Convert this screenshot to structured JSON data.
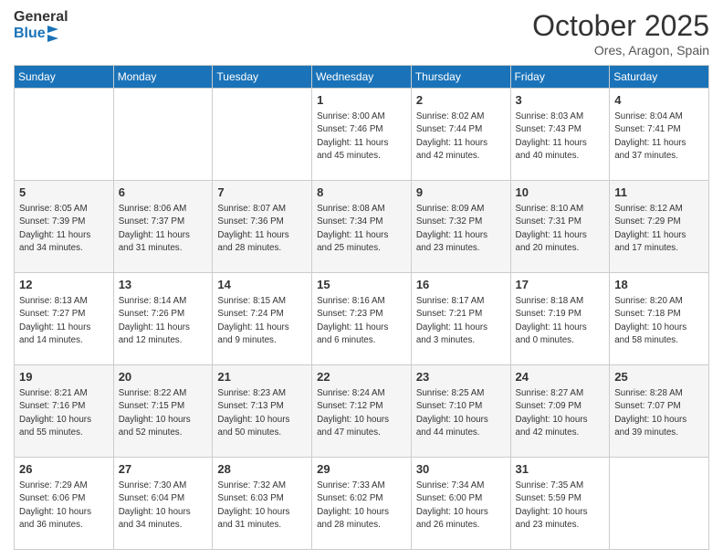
{
  "header": {
    "logo_general": "General",
    "logo_blue": "Blue",
    "month_title": "October 2025",
    "location": "Ores, Aragon, Spain"
  },
  "days_of_week": [
    "Sunday",
    "Monday",
    "Tuesday",
    "Wednesday",
    "Thursday",
    "Friday",
    "Saturday"
  ],
  "weeks": [
    [
      {
        "day": "",
        "info": ""
      },
      {
        "day": "",
        "info": ""
      },
      {
        "day": "",
        "info": ""
      },
      {
        "day": "1",
        "info": "Sunrise: 8:00 AM\nSunset: 7:46 PM\nDaylight: 11 hours\nand 45 minutes."
      },
      {
        "day": "2",
        "info": "Sunrise: 8:02 AM\nSunset: 7:44 PM\nDaylight: 11 hours\nand 42 minutes."
      },
      {
        "day": "3",
        "info": "Sunrise: 8:03 AM\nSunset: 7:43 PM\nDaylight: 11 hours\nand 40 minutes."
      },
      {
        "day": "4",
        "info": "Sunrise: 8:04 AM\nSunset: 7:41 PM\nDaylight: 11 hours\nand 37 minutes."
      }
    ],
    [
      {
        "day": "5",
        "info": "Sunrise: 8:05 AM\nSunset: 7:39 PM\nDaylight: 11 hours\nand 34 minutes."
      },
      {
        "day": "6",
        "info": "Sunrise: 8:06 AM\nSunset: 7:37 PM\nDaylight: 11 hours\nand 31 minutes."
      },
      {
        "day": "7",
        "info": "Sunrise: 8:07 AM\nSunset: 7:36 PM\nDaylight: 11 hours\nand 28 minutes."
      },
      {
        "day": "8",
        "info": "Sunrise: 8:08 AM\nSunset: 7:34 PM\nDaylight: 11 hours\nand 25 minutes."
      },
      {
        "day": "9",
        "info": "Sunrise: 8:09 AM\nSunset: 7:32 PM\nDaylight: 11 hours\nand 23 minutes."
      },
      {
        "day": "10",
        "info": "Sunrise: 8:10 AM\nSunset: 7:31 PM\nDaylight: 11 hours\nand 20 minutes."
      },
      {
        "day": "11",
        "info": "Sunrise: 8:12 AM\nSunset: 7:29 PM\nDaylight: 11 hours\nand 17 minutes."
      }
    ],
    [
      {
        "day": "12",
        "info": "Sunrise: 8:13 AM\nSunset: 7:27 PM\nDaylight: 11 hours\nand 14 minutes."
      },
      {
        "day": "13",
        "info": "Sunrise: 8:14 AM\nSunset: 7:26 PM\nDaylight: 11 hours\nand 12 minutes."
      },
      {
        "day": "14",
        "info": "Sunrise: 8:15 AM\nSunset: 7:24 PM\nDaylight: 11 hours\nand 9 minutes."
      },
      {
        "day": "15",
        "info": "Sunrise: 8:16 AM\nSunset: 7:23 PM\nDaylight: 11 hours\nand 6 minutes."
      },
      {
        "day": "16",
        "info": "Sunrise: 8:17 AM\nSunset: 7:21 PM\nDaylight: 11 hours\nand 3 minutes."
      },
      {
        "day": "17",
        "info": "Sunrise: 8:18 AM\nSunset: 7:19 PM\nDaylight: 11 hours\nand 0 minutes."
      },
      {
        "day": "18",
        "info": "Sunrise: 8:20 AM\nSunset: 7:18 PM\nDaylight: 10 hours\nand 58 minutes."
      }
    ],
    [
      {
        "day": "19",
        "info": "Sunrise: 8:21 AM\nSunset: 7:16 PM\nDaylight: 10 hours\nand 55 minutes."
      },
      {
        "day": "20",
        "info": "Sunrise: 8:22 AM\nSunset: 7:15 PM\nDaylight: 10 hours\nand 52 minutes."
      },
      {
        "day": "21",
        "info": "Sunrise: 8:23 AM\nSunset: 7:13 PM\nDaylight: 10 hours\nand 50 minutes."
      },
      {
        "day": "22",
        "info": "Sunrise: 8:24 AM\nSunset: 7:12 PM\nDaylight: 10 hours\nand 47 minutes."
      },
      {
        "day": "23",
        "info": "Sunrise: 8:25 AM\nSunset: 7:10 PM\nDaylight: 10 hours\nand 44 minutes."
      },
      {
        "day": "24",
        "info": "Sunrise: 8:27 AM\nSunset: 7:09 PM\nDaylight: 10 hours\nand 42 minutes."
      },
      {
        "day": "25",
        "info": "Sunrise: 8:28 AM\nSunset: 7:07 PM\nDaylight: 10 hours\nand 39 minutes."
      }
    ],
    [
      {
        "day": "26",
        "info": "Sunrise: 7:29 AM\nSunset: 6:06 PM\nDaylight: 10 hours\nand 36 minutes."
      },
      {
        "day": "27",
        "info": "Sunrise: 7:30 AM\nSunset: 6:04 PM\nDaylight: 10 hours\nand 34 minutes."
      },
      {
        "day": "28",
        "info": "Sunrise: 7:32 AM\nSunset: 6:03 PM\nDaylight: 10 hours\nand 31 minutes."
      },
      {
        "day": "29",
        "info": "Sunrise: 7:33 AM\nSunset: 6:02 PM\nDaylight: 10 hours\nand 28 minutes."
      },
      {
        "day": "30",
        "info": "Sunrise: 7:34 AM\nSunset: 6:00 PM\nDaylight: 10 hours\nand 26 minutes."
      },
      {
        "day": "31",
        "info": "Sunrise: 7:35 AM\nSunset: 5:59 PM\nDaylight: 10 hours\nand 23 minutes."
      },
      {
        "day": "",
        "info": ""
      }
    ]
  ]
}
